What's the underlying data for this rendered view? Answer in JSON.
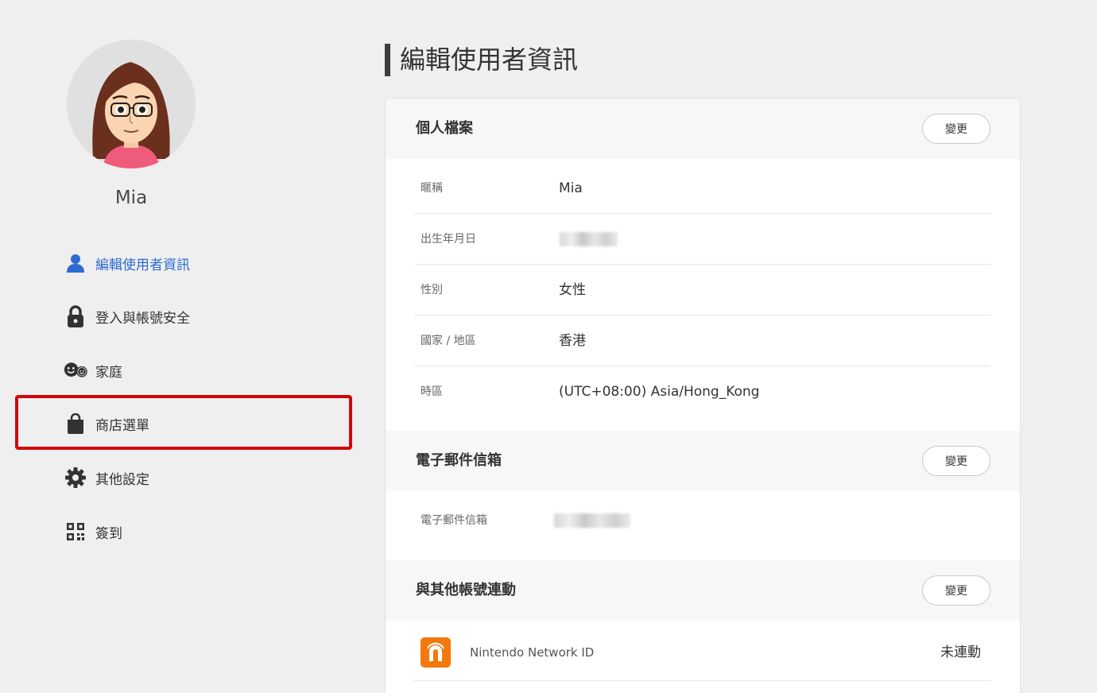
{
  "sidebar": {
    "username": "Mia",
    "items": [
      {
        "label": "編輯使用者資訊",
        "icon": "user-icon"
      },
      {
        "label": "登入與帳號安全",
        "icon": "lock-icon"
      },
      {
        "label": "家庭",
        "icon": "family-icon"
      },
      {
        "label": "商店選單",
        "icon": "shopping-bag-icon"
      },
      {
        "label": "其他設定",
        "icon": "gear-icon"
      },
      {
        "label": "簽到",
        "icon": "qr-code-icon"
      }
    ]
  },
  "main": {
    "title": "編輯使用者資訊",
    "change_label": "變更",
    "profile": {
      "title": "個人檔案",
      "rows": [
        {
          "label": "暱稱",
          "value": "Mia"
        },
        {
          "label": "出生年月日",
          "value": ""
        },
        {
          "label": "性別",
          "value": "女性"
        },
        {
          "label": "國家 / 地區",
          "value": "香港"
        },
        {
          "label": "時區",
          "value": "(UTC+08:00) Asia/Hong_Kong"
        }
      ]
    },
    "email": {
      "title": "電子郵件信箱",
      "label": "電子郵件信箱"
    },
    "linked": {
      "title": "與其他帳號連動",
      "nnid_label": "Nintendo Network ID",
      "nnid_status": "未連動"
    }
  },
  "colors": {
    "active": "#2d6bd3",
    "highlight": "#d0070c",
    "nnid_orange": "#f4780c"
  }
}
